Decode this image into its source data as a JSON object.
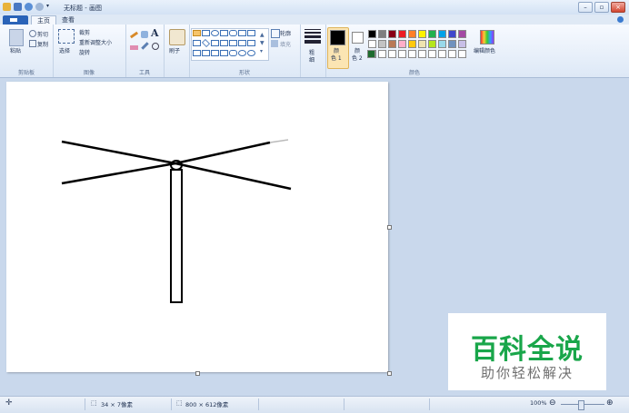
{
  "window": {
    "title": "无标题 - 画图"
  },
  "tabs": [
    "主页",
    "查看"
  ],
  "ribbon": {
    "clipboard": {
      "label": "剪贴板",
      "paste": "粘贴",
      "cut": "剪切",
      "copy": "复制"
    },
    "image": {
      "label": "图像",
      "select": "选择",
      "crop": "裁剪",
      "resize": "重新调整大小",
      "rotate": "旋转"
    },
    "tools": {
      "label": "工具"
    },
    "brushes": {
      "label": "刷子"
    },
    "shapes": {
      "label": "形状",
      "outline": "轮廓",
      "fill": "填充"
    },
    "size": {
      "label1": "粗",
      "label2": "细"
    },
    "colors": {
      "label": "颜色",
      "color1_label1": "颜",
      "color1_label2": "色 1",
      "color2_label1": "颜",
      "color2_label2": "色 2",
      "edit_colors": "编辑颜色",
      "color1": "#000000",
      "color2": "#ffffff",
      "palette_row1": [
        "#000000",
        "#7f7f7f",
        "#880015",
        "#ed1c24",
        "#ff7f27",
        "#fff200",
        "#22b14c",
        "#00a2e8",
        "#3f48cc",
        "#a349a4"
      ],
      "palette_row2": [
        "#ffffff",
        "#c3c3c3",
        "#b97a57",
        "#ffaec9",
        "#ffc90e",
        "#efe4b0",
        "#b5e61d",
        "#99d9ea",
        "#7092be",
        "#c8bfe7"
      ],
      "palette_row3": [
        "#ffffff",
        "#ffffff",
        "#ffffff",
        "#ffffff",
        "#ffffff",
        "#ffffff",
        "#ffffff",
        "#ffffff",
        "#ffffff",
        "#ffffff"
      ],
      "extra_color": "#1e6b2e"
    }
  },
  "status": {
    "cursor_pos": "34 × 7像素",
    "image_size": "800 × 612像素",
    "zoom": "100%"
  },
  "watermark": {
    "main": "百科全说",
    "sub": "助你轻松解决"
  }
}
